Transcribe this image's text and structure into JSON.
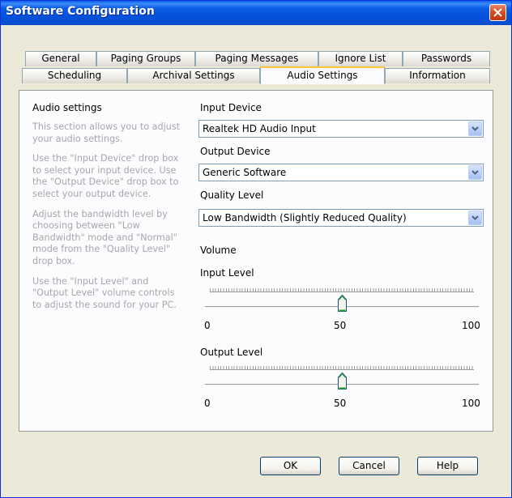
{
  "window": {
    "title": "Software Configuration"
  },
  "tabs": {
    "top_row": [
      "General",
      "Paging Groups",
      "Paging Messages",
      "Ignore List",
      "Passwords"
    ],
    "bottom_row": [
      "Scheduling",
      "Archival Settings",
      "Audio Settings",
      "Information"
    ],
    "active": "Audio Settings"
  },
  "help": {
    "heading": "Audio settings",
    "paragraphs": [
      "This section allows you to adjust\nyour audio settings.",
      "Use the \"Input Device\" drop box\nto select your input device.  Use\nthe \"Output Device\" drop box to\nselect your output device.",
      "Adjust the bandwidth level by\nchoosing between \"Low\nBandwidth\" mode and \"Normal\"\nmode from the \"Quality Level\"\ndrop box.",
      "Use the \"Input Level\" and\n\"Output Level\" volume controls\nto adjust the sound for your PC."
    ]
  },
  "input_device": {
    "label": "Input Device",
    "value": "Realtek HD Audio Input"
  },
  "output_device": {
    "label": "Output Device",
    "value": "Generic Software"
  },
  "quality_level": {
    "label": "Quality Level",
    "value": "Low Bandwidth (Slightly Reduced Quality)"
  },
  "volume": {
    "label": "Volume",
    "input_level": {
      "label": "Input Level",
      "min": "0",
      "mid": "50",
      "max": "100",
      "value": 50
    },
    "output_level": {
      "label": "Output Level",
      "min": "0",
      "mid": "50",
      "max": "100",
      "value": 50
    }
  },
  "buttons": {
    "ok": "OK",
    "cancel": "Cancel",
    "help": "Help"
  },
  "colors": {
    "title_bar": "#0A5FE8",
    "tab_highlight": "#FFC83C",
    "close_button": "#D64A1E",
    "help_text": "#A7A6AA"
  }
}
